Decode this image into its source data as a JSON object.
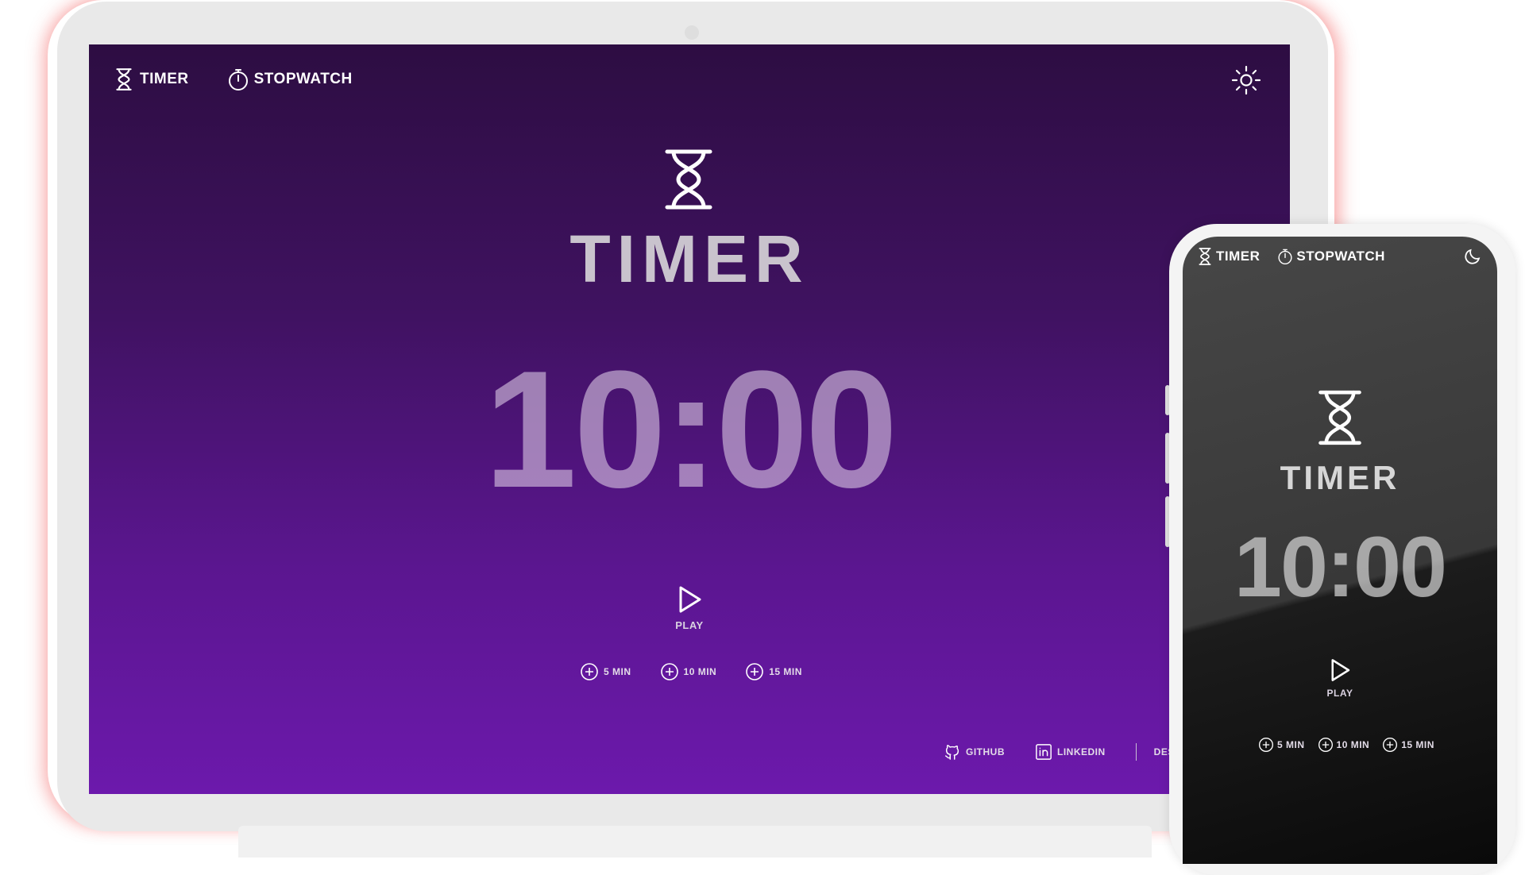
{
  "laptop": {
    "nav": {
      "timer_label": "TIMER",
      "stopwatch_label": "STOPWATCH"
    },
    "theme_icon": "sun-icon",
    "hero": {
      "icon": "hourglass-icon",
      "title": "TIMER"
    },
    "time": "10:00",
    "play": {
      "icon": "play-icon",
      "label": "PLAY"
    },
    "add_buttons": [
      {
        "icon": "plus-circle-icon",
        "label": "5 MIN"
      },
      {
        "icon": "plus-circle-icon",
        "label": "10 MIN"
      },
      {
        "icon": "plus-circle-icon",
        "label": "15 MIN"
      }
    ],
    "footer": {
      "github_label": "GITHUB",
      "linkedin_label": "LINKEDIN",
      "developed_label": "DESENVOLVID"
    },
    "colors": {
      "gradient_top": "#2d0d42",
      "gradient_bottom": "#6c19ac"
    }
  },
  "phone": {
    "nav": {
      "timer_label": "TIMER",
      "stopwatch_label": "STOPWATCH"
    },
    "theme_icon": "moon-icon",
    "hero": {
      "icon": "hourglass-icon",
      "title": "TIMER"
    },
    "time": "10:00",
    "play": {
      "icon": "play-icon",
      "label": "PLAY"
    },
    "add_buttons": [
      {
        "icon": "plus-circle-icon",
        "label": "5 MIN"
      },
      {
        "icon": "plus-circle-icon",
        "label": "10 MIN"
      },
      {
        "icon": "plus-circle-icon",
        "label": "15 MIN"
      }
    ],
    "colors": {
      "background_top": "#474747",
      "background_bottom": "#0a0a0a"
    }
  }
}
